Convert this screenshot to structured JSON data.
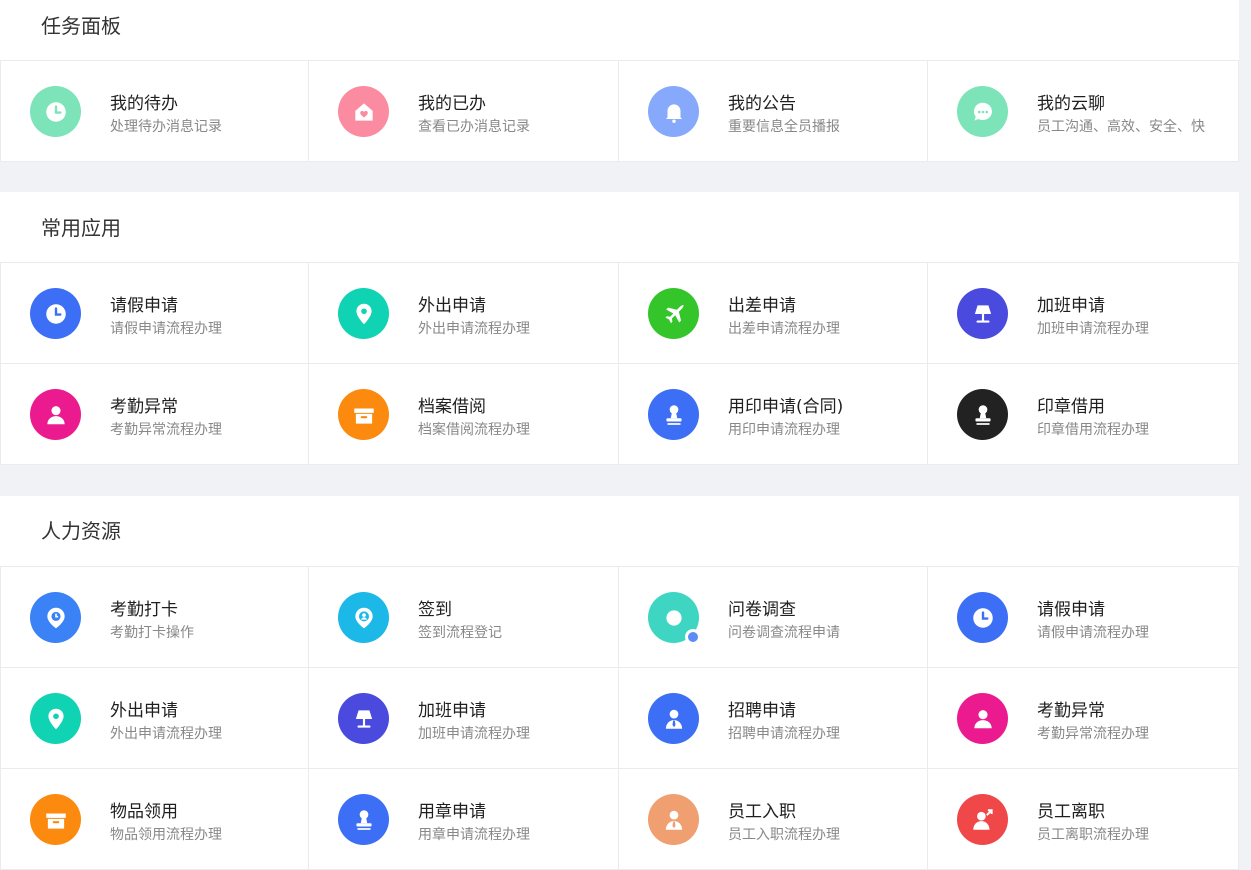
{
  "sections": [
    {
      "title": "任务面板",
      "items": [
        {
          "title": "我的待办",
          "desc": "处理待办消息记录",
          "icon": "clock-icon",
          "color": "#7de3b8"
        },
        {
          "title": "我的已办",
          "desc": "查看已办消息记录",
          "icon": "house-heart-icon",
          "color": "#fb8ba0"
        },
        {
          "title": "我的公告",
          "desc": "重要信息全员播报",
          "icon": "bell-icon",
          "color": "#86a9fb"
        },
        {
          "title": "我的云聊",
          "desc": "员工沟通、高效、安全、快",
          "icon": "chat-icon",
          "color": "#7de3b8"
        }
      ]
    },
    {
      "title": "常用应用",
      "items": [
        {
          "title": "请假申请",
          "desc": "请假申请流程办理",
          "icon": "clock-icon",
          "color": "#3c6ff5"
        },
        {
          "title": "外出申请",
          "desc": "外出申请流程办理",
          "icon": "location-pin-icon",
          "color": "#10d3b4"
        },
        {
          "title": "出差申请",
          "desc": "出差申请流程办理",
          "icon": "airplane-icon",
          "color": "#34c52a"
        },
        {
          "title": "加班申请",
          "desc": "加班申请流程办理",
          "icon": "lamp-icon",
          "color": "#4a4adf"
        },
        {
          "title": "考勤异常",
          "desc": "考勤异常流程办理",
          "icon": "person-icon",
          "color": "#ec1a8f"
        },
        {
          "title": "档案借阅",
          "desc": "档案借阅流程办理",
          "icon": "box-icon",
          "color": "#fb8a0e"
        },
        {
          "title": "用印申请(合同)",
          "desc": "用印申请流程办理",
          "icon": "stamp-icon",
          "color": "#3c6ff5"
        },
        {
          "title": "印章借用",
          "desc": "印章借用流程办理",
          "icon": "stamp-icon",
          "color": "#222222"
        }
      ]
    },
    {
      "title": "人力资源",
      "items": [
        {
          "title": "考勤打卡",
          "desc": "考勤打卡操作",
          "icon": "clock-pin-icon",
          "color": "#3b82f6"
        },
        {
          "title": "签到",
          "desc": "签到流程登记",
          "icon": "user-pin-icon",
          "color": "#1cb8e8"
        },
        {
          "title": "问卷调查",
          "desc": "问卷调查流程申请",
          "icon": "survey-icon",
          "color": "#3ed6c3"
        },
        {
          "title": "请假申请",
          "desc": "请假申请流程办理",
          "icon": "clock-icon",
          "color": "#3c6ff5"
        },
        {
          "title": "外出申请",
          "desc": "外出申请流程办理",
          "icon": "location-pin-icon",
          "color": "#10d3b4"
        },
        {
          "title": "加班申请",
          "desc": "加班申请流程办理",
          "icon": "lamp-icon",
          "color": "#4a4adf"
        },
        {
          "title": "招聘申请",
          "desc": "招聘申请流程办理",
          "icon": "person-tie-icon",
          "color": "#3c6ff5"
        },
        {
          "title": "考勤异常",
          "desc": "考勤异常流程办理",
          "icon": "person-icon",
          "color": "#ec1a8f"
        },
        {
          "title": "物品领用",
          "desc": "物品领用流程办理",
          "icon": "box-icon",
          "color": "#fb8a0e"
        },
        {
          "title": "用章申请",
          "desc": "用章申请流程办理",
          "icon": "stamp-icon",
          "color": "#3c6ff5"
        },
        {
          "title": "员工入职",
          "desc": "员工入职流程办理",
          "icon": "person-tie-icon",
          "color": "#f0a070"
        },
        {
          "title": "员工离职",
          "desc": "员工离职流程办理",
          "icon": "person-exit-icon",
          "color": "#f04848"
        }
      ]
    }
  ]
}
